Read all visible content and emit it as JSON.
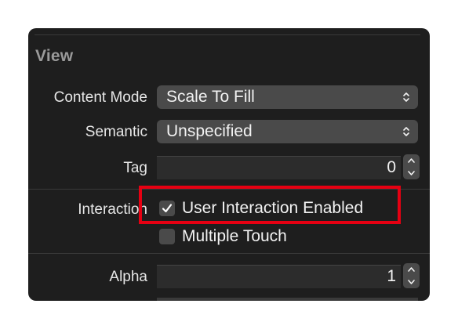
{
  "inspector": {
    "section_title": "View",
    "content_mode": {
      "label": "Content Mode",
      "value": "Scale To Fill"
    },
    "semantic": {
      "label": "Semantic",
      "value": "Unspecified"
    },
    "tag": {
      "label": "Tag",
      "value": "0"
    },
    "interaction": {
      "label": "Interaction",
      "user_interaction": {
        "label": "User Interaction Enabled",
        "checked": true
      },
      "multiple_touch": {
        "label": "Multiple Touch",
        "checked": false
      }
    },
    "alpha": {
      "label": "Alpha",
      "value": "1"
    }
  },
  "annotation": {
    "color": "#e60012"
  },
  "icons": {
    "popup": "chevron-up-down-icon",
    "stepper": "stepper-arrows-icon",
    "check": "checkmark-icon"
  }
}
